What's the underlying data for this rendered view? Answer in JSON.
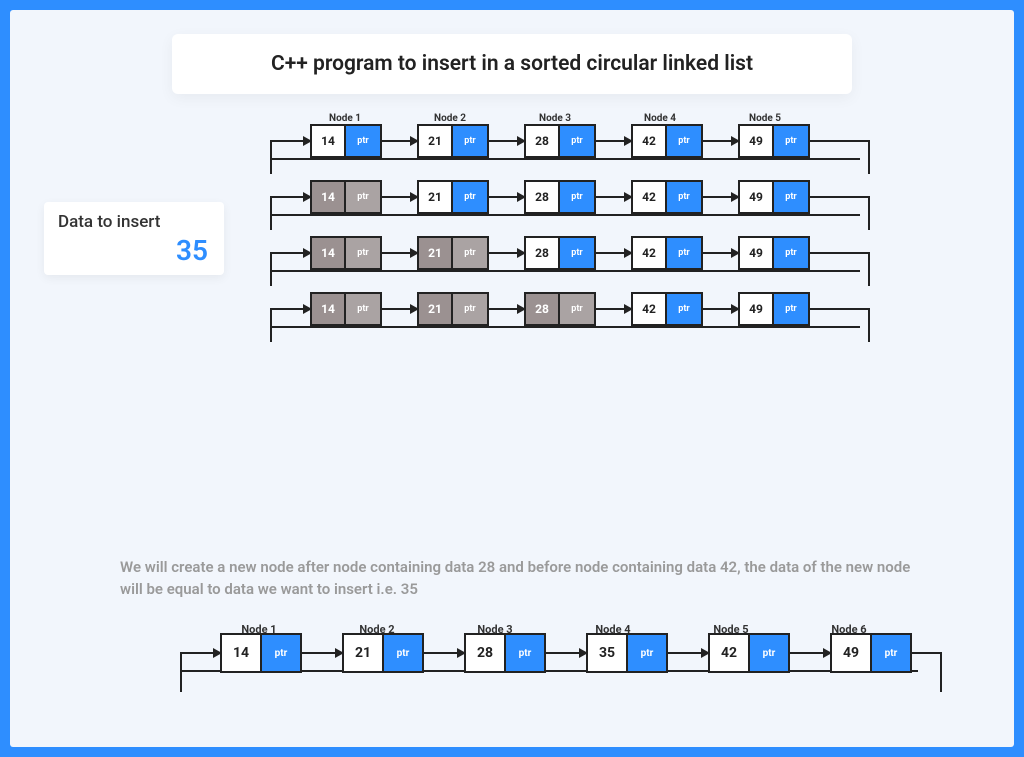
{
  "title": "C++ program to insert in a sorted circular linked list",
  "insert_card": {
    "label": "Data to insert",
    "value": "35"
  },
  "ptr_label": "ptr",
  "node_label_prefix": "Node ",
  "rows": [
    {
      "show_labels": true,
      "nodes": [
        {
          "v": "14",
          "gray": false
        },
        {
          "v": "21",
          "gray": false
        },
        {
          "v": "28",
          "gray": false
        },
        {
          "v": "42",
          "gray": false
        },
        {
          "v": "49",
          "gray": false
        }
      ]
    },
    {
      "show_labels": false,
      "nodes": [
        {
          "v": "14",
          "gray": true
        },
        {
          "v": "21",
          "gray": false
        },
        {
          "v": "28",
          "gray": false
        },
        {
          "v": "42",
          "gray": false
        },
        {
          "v": "49",
          "gray": false
        }
      ]
    },
    {
      "show_labels": false,
      "nodes": [
        {
          "v": "14",
          "gray": true
        },
        {
          "v": "21",
          "gray": true
        },
        {
          "v": "28",
          "gray": false
        },
        {
          "v": "42",
          "gray": false
        },
        {
          "v": "49",
          "gray": false
        }
      ]
    },
    {
      "show_labels": false,
      "nodes": [
        {
          "v": "14",
          "gray": true
        },
        {
          "v": "21",
          "gray": true
        },
        {
          "v": "28",
          "gray": true
        },
        {
          "v": "42",
          "gray": false
        },
        {
          "v": "49",
          "gray": false
        }
      ]
    }
  ],
  "description": "We will create a new node after node containing data 28 and before node containing data 42, the data of the new node will be equal to data we want to insert i.e. 35",
  "final": {
    "show_labels": true,
    "nodes": [
      {
        "v": "14"
      },
      {
        "v": "21"
      },
      {
        "v": "28"
      },
      {
        "v": "35"
      },
      {
        "v": "42"
      },
      {
        "v": "49"
      }
    ]
  }
}
